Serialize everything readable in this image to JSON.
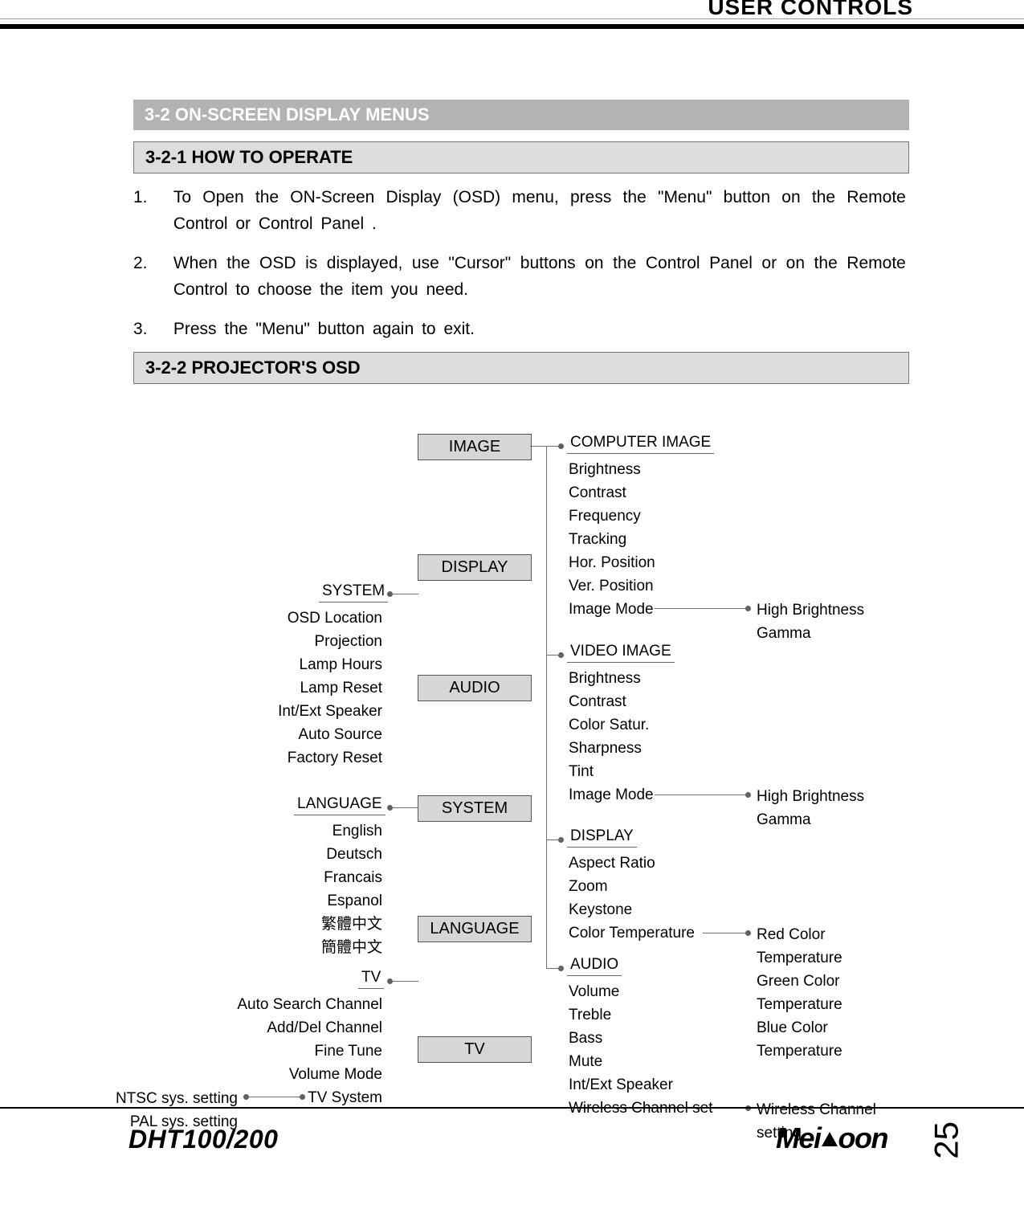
{
  "header": {
    "title": "USER CONTROLS"
  },
  "sections": {
    "s1": "3-2    ON-SCREEN DISPLAY MENUS",
    "s2": "3-2-1    HOW TO OPERATE",
    "s3": "3-2-2    PROJECTOR'S OSD"
  },
  "instructions": [
    "To Open the ON-Screen Display (OSD) menu, press the \"Menu\" button on the Remote Control or Control Panel .",
    "When the OSD is displayed, use \"Cursor\" buttons on the Control Panel or on the Remote Control to choose the item you need.",
    "Press the \"Menu\" button again to exit."
  ],
  "menu": {
    "image": "IMAGE",
    "display": "DISPLAY",
    "audio": "AUDIO",
    "system": "SYSTEM",
    "language": "LANGUAGE",
    "tv": "TV"
  },
  "labels": {
    "computer_image": "COMPUTER IMAGE",
    "video_image": "VIDEO IMAGE",
    "display_lbl": "DISPLAY",
    "audio_lbl": "AUDIO",
    "system_lbl": "SYSTEM",
    "language_lbl": "LANGUAGE",
    "tv_lbl": "TV"
  },
  "computer_image_items": [
    "Brightness",
    "Contrast",
    "Frequency",
    "Tracking",
    "Hor. Position",
    "Ver. Position",
    "Image Mode"
  ],
  "image_mode_opts_1": [
    "High Brightness",
    "Gamma"
  ],
  "video_image_items": [
    "Brightness",
    "Contrast",
    "Color Satur.",
    "Sharpness",
    "Tint",
    "Image Mode"
  ],
  "image_mode_opts_2": [
    "High Brightness",
    "Gamma"
  ],
  "display_items": [
    "Aspect Ratio",
    "Zoom",
    "Keystone",
    "Color Temperature"
  ],
  "color_temp_opts": [
    "Red Color",
    "Temperature",
    "Green Color",
    "Temperature",
    "Blue Color",
    "Temperature"
  ],
  "audio_items": [
    "Volume",
    "Treble",
    "Bass",
    "Mute",
    "Int/Ext Speaker",
    "Wireless Channel set"
  ],
  "wireless_opts": [
    "Wireless Channel",
    "setting"
  ],
  "system_items": [
    "OSD Location",
    "Projection",
    "Lamp Hours",
    "Lamp Reset",
    "Int/Ext Speaker",
    "Auto Source",
    "Factory Reset"
  ],
  "language_items": [
    "English",
    "Deutsch",
    "Francais",
    "Espanol",
    "繁體中文",
    "簡體中文"
  ],
  "tv_items": [
    "Auto Search Channel",
    "Add/Del Channel",
    "Fine Tune",
    "Volume Mode",
    "TV System"
  ],
  "tv_system_opts": [
    "NTSC sys. setting",
    "PAL sys. setting"
  ],
  "footer": {
    "model": "DHT100/200",
    "brand_left": "Mei",
    "brand_right": "oon",
    "page": "25"
  }
}
